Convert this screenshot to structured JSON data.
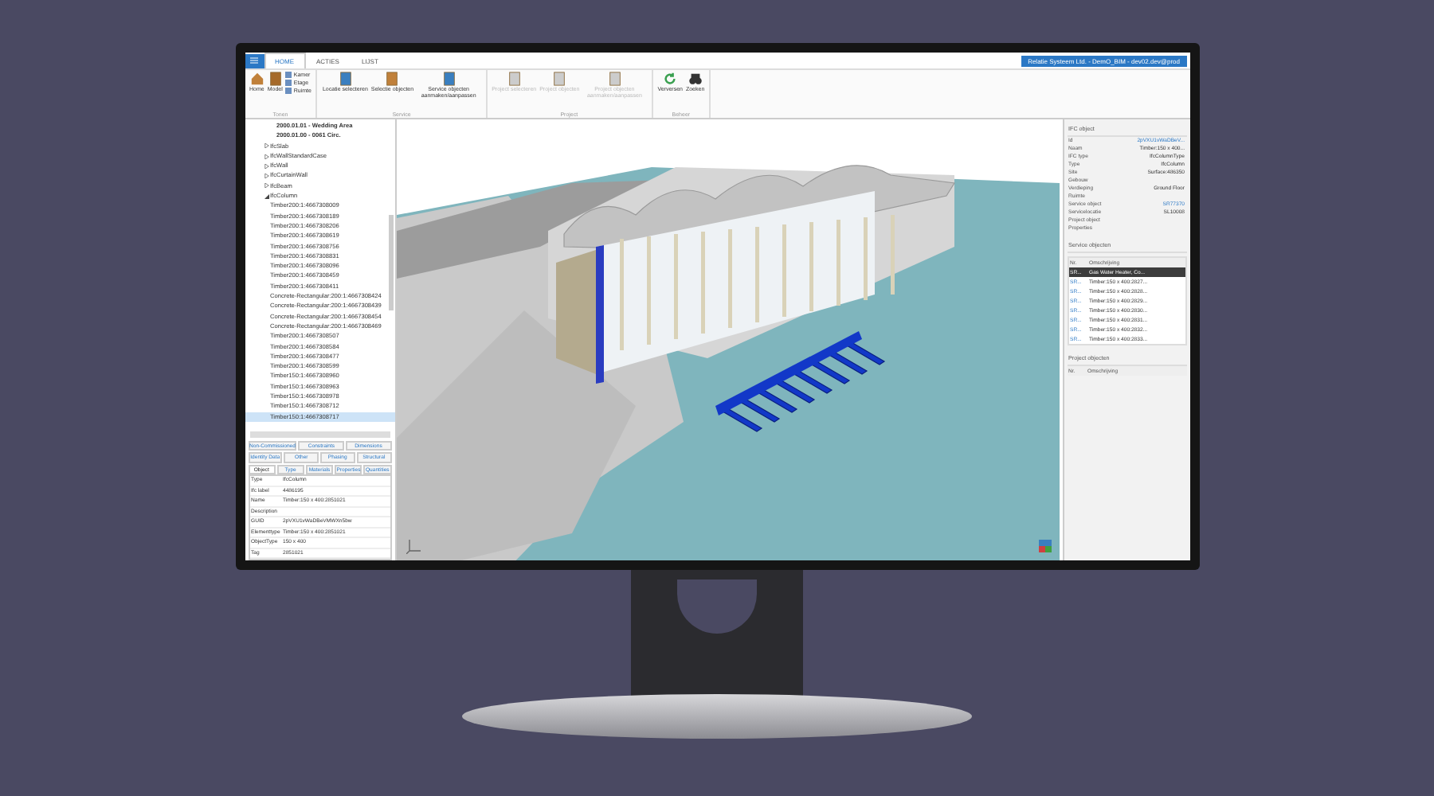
{
  "window": {
    "title": "Relatie Systeem Ltd. - DemO_BIM - dev02.dev@prod"
  },
  "tabs": [
    {
      "label": "HOME",
      "selected": true
    },
    {
      "label": "ACTIES",
      "selected": false
    },
    {
      "label": "LIJST",
      "selected": false
    }
  ],
  "ribbon": {
    "groups": [
      {
        "label": "Tonen",
        "buttons": [
          {
            "label": "Home",
            "kind": "large",
            "disabled": false
          },
          {
            "label": "Model",
            "kind": "large",
            "disabled": false
          },
          {
            "label": "Kamer",
            "kind": "small",
            "disabled": false
          },
          {
            "label": "Etage",
            "kind": "small",
            "disabled": false
          },
          {
            "label": "Ruimte",
            "kind": "small",
            "disabled": false
          }
        ]
      },
      {
        "label": "Service",
        "buttons": [
          {
            "label": "Locatie selecteren",
            "kind": "large",
            "disabled": false
          },
          {
            "label": "Selectie objecten",
            "kind": "large",
            "disabled": false
          },
          {
            "label": "Service objecten aanmaken/aanpassen",
            "kind": "large",
            "disabled": false
          }
        ]
      },
      {
        "label": "Project",
        "buttons": [
          {
            "label": "Project selecteren",
            "kind": "large",
            "disabled": true
          },
          {
            "label": "Project objecten",
            "kind": "large",
            "disabled": true
          },
          {
            "label": "Project objecten aanmaken/aanpassen",
            "kind": "large",
            "disabled": true
          }
        ]
      },
      {
        "label": "Beheer",
        "buttons": [
          {
            "label": "Verversen",
            "kind": "large",
            "disabled": false
          },
          {
            "label": "Zoeken",
            "kind": "large",
            "disabled": false
          }
        ]
      }
    ]
  },
  "tree": {
    "items": [
      {
        "label": "2000.01.01 - Wedding Area",
        "kind": "heading",
        "selected": false
      },
      {
        "label": "2000.01.00 - 0061 Circ.",
        "kind": "heading",
        "selected": false
      },
      {
        "label": "IfcSlab",
        "kind": "node",
        "expanded": false,
        "selected": false
      },
      {
        "label": "IfcWallStandardCase",
        "kind": "node",
        "expanded": false,
        "selected": false
      },
      {
        "label": "IfcWall",
        "kind": "node",
        "expanded": false,
        "selected": false
      },
      {
        "label": "IfcCurtainWall",
        "kind": "node",
        "expanded": false,
        "selected": false
      },
      {
        "label": "IfcBeam",
        "kind": "node",
        "expanded": false,
        "selected": false
      },
      {
        "label": "IfcColumn",
        "kind": "node",
        "expanded": true,
        "selected": false,
        "children": [
          {
            "label": "Timber200:1:4667308009",
            "selected": false
          },
          {
            "label": "Timber200:1:4667308189",
            "selected": false
          },
          {
            "label": "Timber200:1:4667308206",
            "selected": false
          },
          {
            "label": "Timber200:1:4667308619",
            "selected": false
          },
          {
            "label": "Timber200:1:4667308756",
            "selected": false
          },
          {
            "label": "Timber200:1:4667308831",
            "selected": false
          },
          {
            "label": "Timber200:1:4667308096",
            "selected": false
          },
          {
            "label": "Timber200:1:4667308459",
            "selected": false
          },
          {
            "label": "Timber200:1:4667308411",
            "selected": false
          },
          {
            "label": "Concrete-Rectangular:200:1:4667308424",
            "selected": false
          },
          {
            "label": "Concrete-Rectangular:200:1:4667308439",
            "selected": false
          },
          {
            "label": "Concrete-Rectangular:200:1:4667308454",
            "selected": false
          },
          {
            "label": "Concrete-Rectangular:200:1:4667308469",
            "selected": false
          },
          {
            "label": "Timber200:1:4667308507",
            "selected": false
          },
          {
            "label": "Timber200:1:4667308584",
            "selected": false
          },
          {
            "label": "Timber200:1:4667308477",
            "selected": false
          },
          {
            "label": "Timber200:1:4667308599",
            "selected": false
          },
          {
            "label": "Timber150:1:4667308960",
            "selected": false
          },
          {
            "label": "Timber150:1:4667308963",
            "selected": false
          },
          {
            "label": "Timber150:1:4667308978",
            "selected": false
          },
          {
            "label": "Timber150:1:4667308712",
            "selected": false
          },
          {
            "label": "Timber150:1:4667308717",
            "selected": true
          }
        ]
      }
    ]
  },
  "property_tabs": {
    "rows": [
      {
        "tabs": [
          {
            "label": "Non-Commissioned",
            "selected": false
          },
          {
            "label": "Constraints",
            "selected": false
          },
          {
            "label": "Dimensions",
            "selected": false
          }
        ]
      },
      {
        "tabs": [
          {
            "label": "Identity Data",
            "selected": false
          },
          {
            "label": "Other",
            "selected": false
          },
          {
            "label": "Phasing",
            "selected": false
          },
          {
            "label": "Structural",
            "selected": false
          }
        ]
      },
      {
        "tabs": [
          {
            "label": "Object",
            "selected": true
          },
          {
            "label": "Type",
            "selected": false
          },
          {
            "label": "Materials",
            "selected": false
          },
          {
            "label": "Properties",
            "selected": false
          },
          {
            "label": "Quantities",
            "selected": false
          }
        ]
      }
    ]
  },
  "properties": [
    {
      "name": "Type",
      "value": "IfcColumn"
    },
    {
      "name": "Ifc label",
      "value": "4486195"
    },
    {
      "name": "Name",
      "value": "Timber:150 x 400:2851021"
    },
    {
      "name": "Description"
    },
    {
      "name": "GUID",
      "value": "2pVXU1vWaDBeVMWXn5bw"
    },
    {
      "name": "Elementtype",
      "value": "Timber:150 x 400:2851021"
    },
    {
      "name": "ObjectType",
      "value": "150 x 400"
    },
    {
      "name": "Tag",
      "value": "2851021"
    }
  ],
  "ifc_object": {
    "title": "IFC object",
    "fields": [
      {
        "name": "Id",
        "value": "2pVXU1vWaDBeV...",
        "kind": "link"
      },
      {
        "name": "Naam",
        "value": "Timber:150 x 400...",
        "kind": "text"
      },
      {
        "name": "IFC type",
        "value": "IfcColumnType",
        "kind": "text"
      },
      {
        "name": "Type",
        "value": "IfcColumn",
        "kind": "text"
      },
      {
        "name": "Site",
        "value": "Surface:486350",
        "kind": "text"
      },
      {
        "name": "Gebouw"
      },
      {
        "name": "Verdieping",
        "value": "Ground Floor",
        "kind": "text"
      },
      {
        "name": "Ruimte"
      },
      {
        "name": "Service object",
        "value": "SR77370",
        "kind": "link"
      },
      {
        "name": "Servicelocatie",
        "value": "SL10008",
        "kind": "text"
      },
      {
        "name": "Project object"
      },
      {
        "name": "Properties"
      }
    ]
  },
  "service_objects": {
    "title": "Service objecten",
    "columns": [
      "Nr.",
      "Omschrijving"
    ],
    "rows": [
      {
        "nr": "SR...",
        "description": "Gas Water Heater, Co...",
        "selected": true
      },
      {
        "nr": "SR...",
        "description": "Timber:150 x 400:2827...",
        "selected": false
      },
      {
        "nr": "SR...",
        "description": "Timber:150 x 400:2828...",
        "selected": false
      },
      {
        "nr": "SR...",
        "description": "Timber:150 x 400:2829...",
        "selected": false
      },
      {
        "nr": "SR...",
        "description": "Timber:150 x 400:2830...",
        "selected": false
      },
      {
        "nr": "SR...",
        "description": "Timber:150 x 400:2831...",
        "selected": false
      },
      {
        "nr": "SR...",
        "description": "Timber:150 x 400:2832...",
        "selected": false
      },
      {
        "nr": "SR...",
        "description": "Timber:150 x 400:2833...",
        "selected": false
      }
    ]
  },
  "project_objects": {
    "title": "Project objecten",
    "columns": [
      "Nr.",
      "Omschrijving"
    ]
  }
}
